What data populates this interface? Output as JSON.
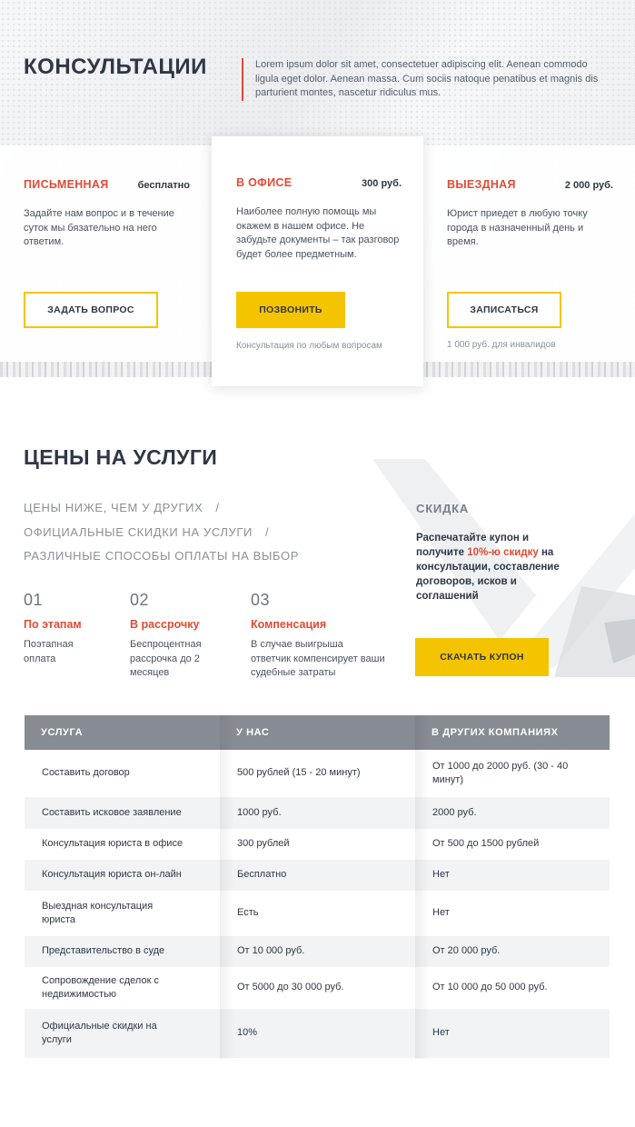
{
  "consult": {
    "title": "КОНСУЛЬТАЦИИ",
    "description": "Lorem ipsum dolor sit amet, consectetuer adipiscing elit. Aenean commodo ligula eget dolor. Aenean massa. Cum sociis natoque penatibus et magnis dis parturient montes, nascetur ridiculus mus.",
    "cards": [
      {
        "name": "ПИСЬМЕННАЯ",
        "price": "бесплатно",
        "text": "Задайте нам вопрос и в течение суток мы бязательно на него ответим.",
        "button": "ЗАДАТЬ ВОПРОС",
        "note": ""
      },
      {
        "name": "В ОФИСЕ",
        "price": "300 руб.",
        "text": "Наиболее полную помощь мы окажем в нашем офисе. Не забудьте документы – так разговор будет более предметным.",
        "button": "ПОЗВОНИТЬ",
        "note": "Консультация по любым вопросам"
      },
      {
        "name": "ВЫЕЗДНАЯ",
        "price": "2 000 руб.",
        "text": "Юрист приедет в любую точку города в назначенный день и время.",
        "button": "ЗАПИСАТЬСЯ",
        "note": "1 000 руб. для инвалидов"
      }
    ]
  },
  "prices": {
    "title": "ЦЕНЫ НА УСЛУГИ",
    "benefits": [
      "ЦЕНЫ НИЖЕ, ЧЕМ У ДРУГИХ",
      "ОФИЦИАЛЬНЫЕ СКИДКИ  НА УСЛУГИ",
      "РАЗЛИЧНЫЕ СПОСОБЫ ОПЛАТЫ НА ВЫБОР"
    ],
    "separator": "/",
    "steps": [
      {
        "num": "01",
        "name": "По этапам",
        "text": "Поэтапная оплата"
      },
      {
        "num": "02",
        "name": "В рассрочку",
        "text": "Беспроцентная рассрочка до 2 месяцев"
      },
      {
        "num": "03",
        "name": "Компенсация",
        "text": "В случае выигрыша ответчик компенсирует ваши судебные затраты"
      }
    ],
    "discount": {
      "title": "СКИДКА",
      "text_before": "Распечатайте купон и получите ",
      "text_highlight": "10%-ю скидку",
      "text_after": " на консультации, составление договоров, исков и соглашений",
      "button": "СКАЧАТЬ КУПОН"
    }
  },
  "table": {
    "headers": [
      "УСЛУГА",
      "У НАС",
      "В ДРУГИХ КОМПАНИЯХ"
    ],
    "rows": [
      [
        "Составить договор",
        "500 рублей (15 - 20 минут)",
        "От 1000 до 2000 руб. (30 - 40 минут)"
      ],
      [
        "Составить исковое заявление",
        "1000 руб.",
        "2000 руб."
      ],
      [
        "Консультация юриста в офисе",
        "300 рублей",
        "От 500 до 1500 рублей"
      ],
      [
        "Консультация юриста он-лайн",
        "Бесплатно",
        "Нет"
      ],
      [
        "Выездная консультация юриста",
        "Есть",
        "Нет"
      ],
      [
        "Представительство в суде",
        "От 10 000 руб.",
        "От 20 000 руб."
      ],
      [
        "Сопровождение сделок с недвижимостью",
        "От 5000 до 30 000 руб.",
        "От 10 000 до 50 000 руб."
      ],
      [
        "Официальные скидки на услуги",
        "10%",
        "Нет"
      ]
    ]
  },
  "colors": {
    "accent_red": "#e14b34",
    "accent_yellow": "#f5c400",
    "dark_text": "#2f3746",
    "table_header": "#878b92"
  }
}
